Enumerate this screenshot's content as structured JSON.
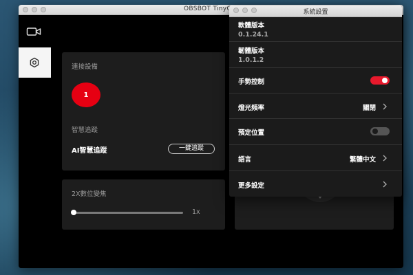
{
  "window": {
    "title": "OBSBOT TinyC"
  },
  "sidebar": {
    "items": [
      {
        "name": "camera-icon"
      },
      {
        "name": "settings-hexagon-icon",
        "active": true
      }
    ]
  },
  "device_card": {
    "title": "連接設備",
    "device_number": "1",
    "tracking_section": "智慧追蹤",
    "ai_tracking_label": "AI智慧追蹤",
    "one_click_button": "一鍵追蹤"
  },
  "zoom_card": {
    "title": "2X數位變焦",
    "value": "1x",
    "level": 0
  },
  "settings_dialog": {
    "title": "系統設置",
    "software_version_label": "軟體版本",
    "software_version": "0.1.24.1",
    "firmware_version_label": "韌體版本",
    "firmware_version": "1.0.1.2",
    "gesture_label": "手勢控制",
    "gesture_on": true,
    "flicker_label": "燈光頻率",
    "flicker_value": "關閉",
    "preset_label": "預定位置",
    "preset_on": false,
    "language_label": "語言",
    "language_value": "繁體中文",
    "more_label": "更多設定"
  },
  "colors": {
    "accent_red": "#e60012",
    "toggle_on": "#e8192c",
    "toggle_off": "#555555",
    "panel": "#1d1d1d",
    "dialog_bg": "#1b1b1b"
  }
}
